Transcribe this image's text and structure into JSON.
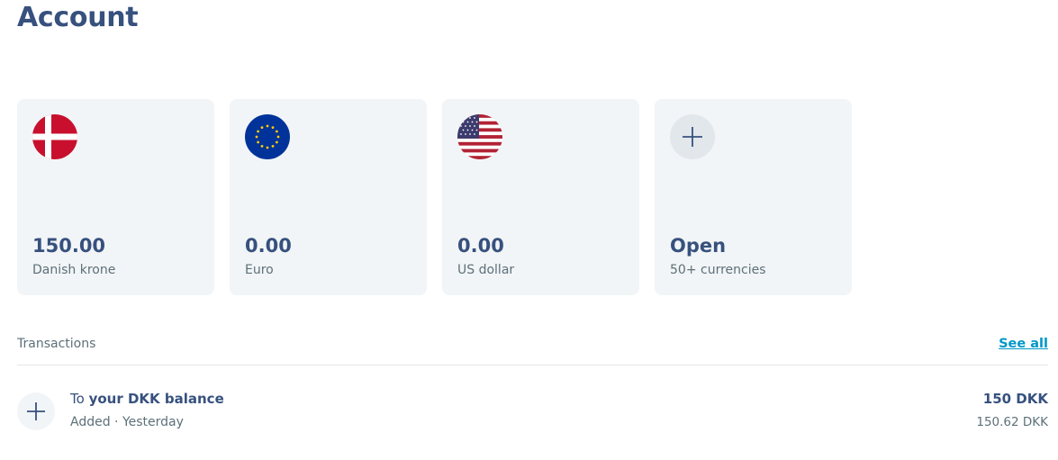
{
  "page": {
    "title": "Account"
  },
  "balances": [
    {
      "amount": "150.00",
      "currency": "Danish krone",
      "flag_icon": "denmark-flag-icon"
    },
    {
      "amount": "0.00",
      "currency": "Euro",
      "flag_icon": "eu-flag-icon"
    },
    {
      "amount": "0.00",
      "currency": "US dollar",
      "flag_icon": "us-flag-icon"
    }
  ],
  "open_card": {
    "label": "Open",
    "sublabel": "50+ currencies",
    "icon": "plus-icon"
  },
  "transactions": {
    "title": "Transactions",
    "see_all": "See all",
    "items": [
      {
        "prefix": "To",
        "name": "your DKK balance",
        "status": "Added · Yesterday",
        "amount": "150 DKK",
        "secondary_amount": "150.62 DKK",
        "icon": "plus-icon"
      }
    ]
  },
  "colors": {
    "title": "#37517e",
    "card_bg": "#f2f5f7",
    "link": "#0097c7",
    "muted_text": "#5d7079"
  }
}
